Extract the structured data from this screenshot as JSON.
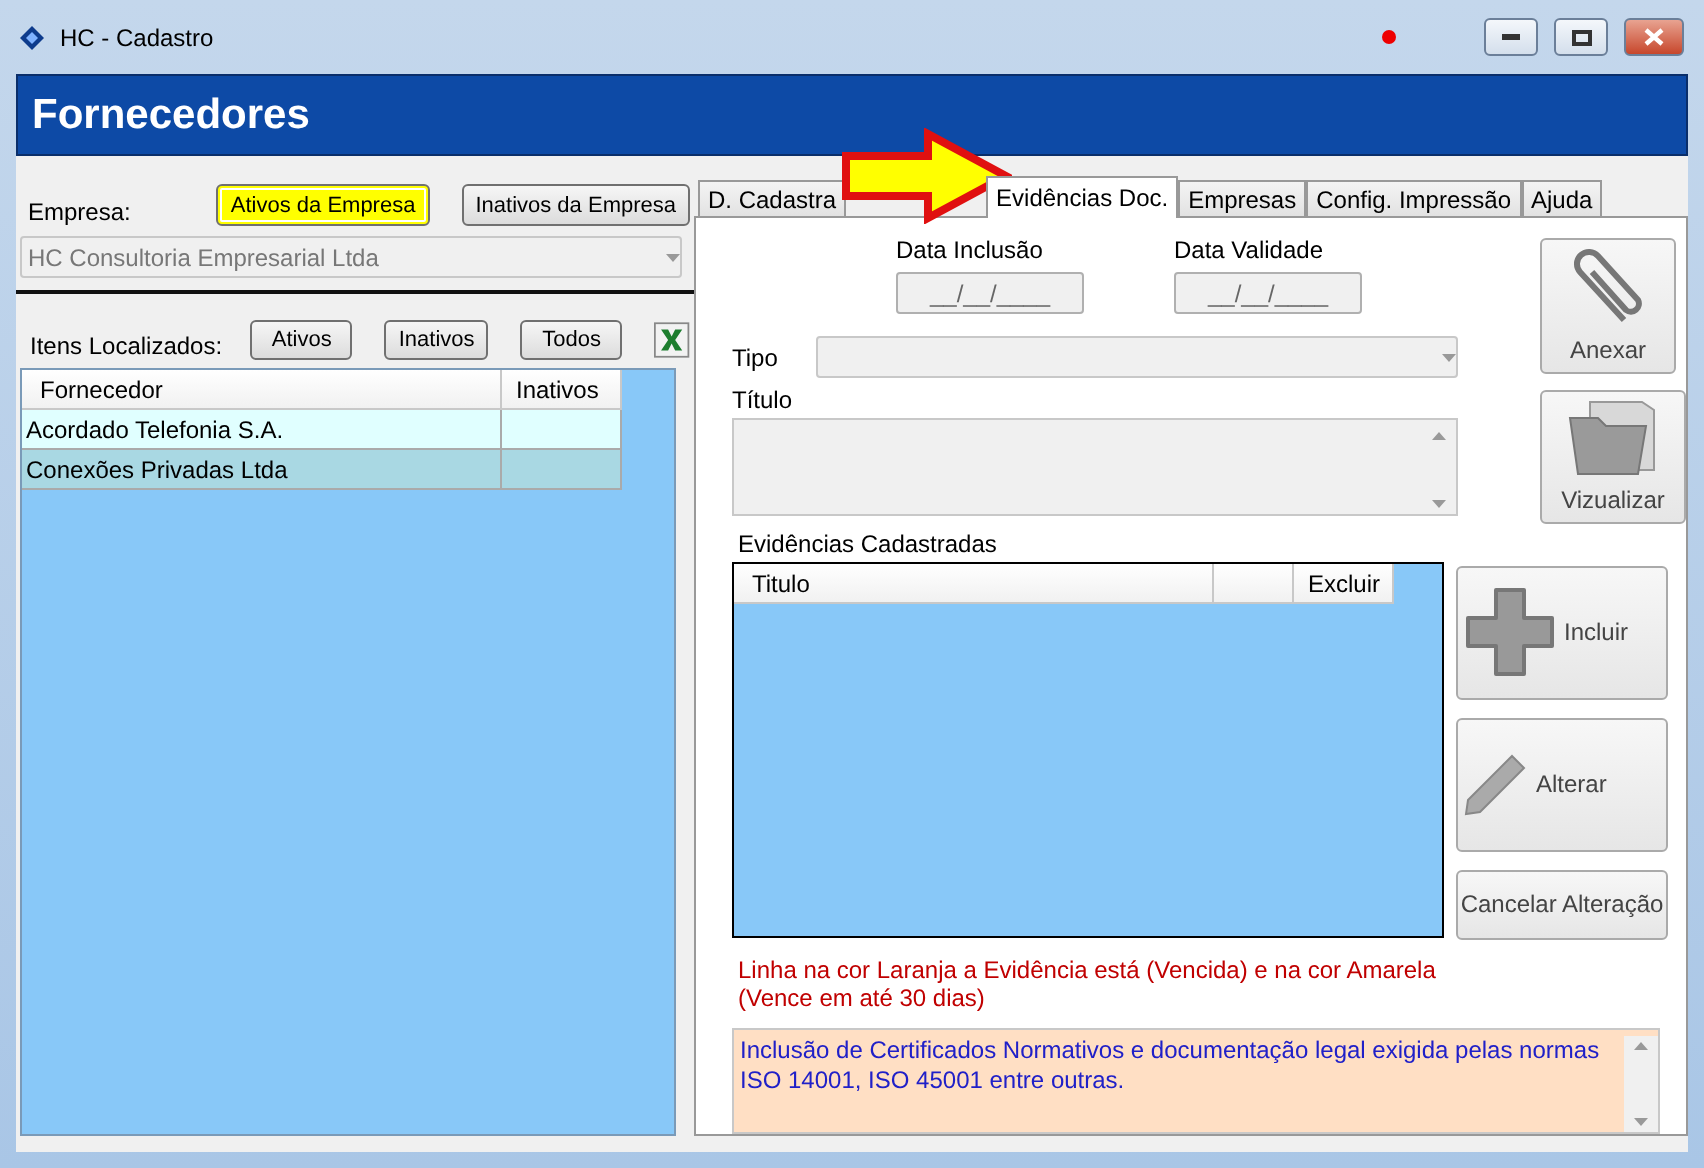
{
  "window": {
    "title": "HC - Cadastro"
  },
  "header": {
    "title": "Fornecedores"
  },
  "left": {
    "empresa_label": "Empresa:",
    "empresa_buttons": [
      {
        "label": "Ativos da Empresa",
        "selected": true
      },
      {
        "label": "Inativos da Empresa",
        "selected": false
      }
    ],
    "empresa_combo": {
      "value": "HC Consultoria Empresarial Ltda"
    },
    "itens_label": "Itens Localizados:",
    "filter_buttons": [
      "Ativos",
      "Inativos",
      "Todos"
    ],
    "table": {
      "columns": [
        "Fornecedor",
        "Inativos"
      ],
      "rows": [
        {
          "cells": [
            "Acordado Telefonia S.A.",
            ""
          ],
          "selected": false
        },
        {
          "cells": [
            "Conexões Privadas Ltda",
            ""
          ],
          "selected": true
        }
      ]
    }
  },
  "tabs": [
    {
      "label": "D. Cadastra",
      "selected": false
    },
    {
      "label": "Evidências Doc.",
      "selected": true
    },
    {
      "label": "Empresas",
      "selected": false
    },
    {
      "label": "Config. Impressão",
      "selected": false
    },
    {
      "label": "Ajuda",
      "selected": false
    }
  ],
  "form": {
    "dates": [
      {
        "label": "Data Inclusão",
        "value": "__/__/____"
      },
      {
        "label": "Data Validade",
        "value": "__/__/____"
      }
    ],
    "tipo_label": "Tipo",
    "titulo_label": "Título",
    "side_buttons": [
      {
        "kind": "attach",
        "label": "Anexar"
      },
      {
        "kind": "view",
        "label": "Vizualizar"
      }
    ],
    "evidencias_label": "Evidências Cadastradas",
    "evidencias_columns": [
      "Titulo",
      "",
      "Excluir"
    ],
    "action_buttons": [
      {
        "kind": "add",
        "label": "Incluir"
      },
      {
        "kind": "edit",
        "label": "Alterar"
      },
      {
        "kind": "cancel",
        "label": "Cancelar Alteração"
      }
    ],
    "legend": "Linha na cor Laranja a Evidência está (Vencida) e na cor Amarela (Vence em até 30 dias)",
    "info": "Inclusão de Certificados Normativos e documentação legal exigida pelas normas ISO 14001, ISO 45001 entre outras."
  }
}
